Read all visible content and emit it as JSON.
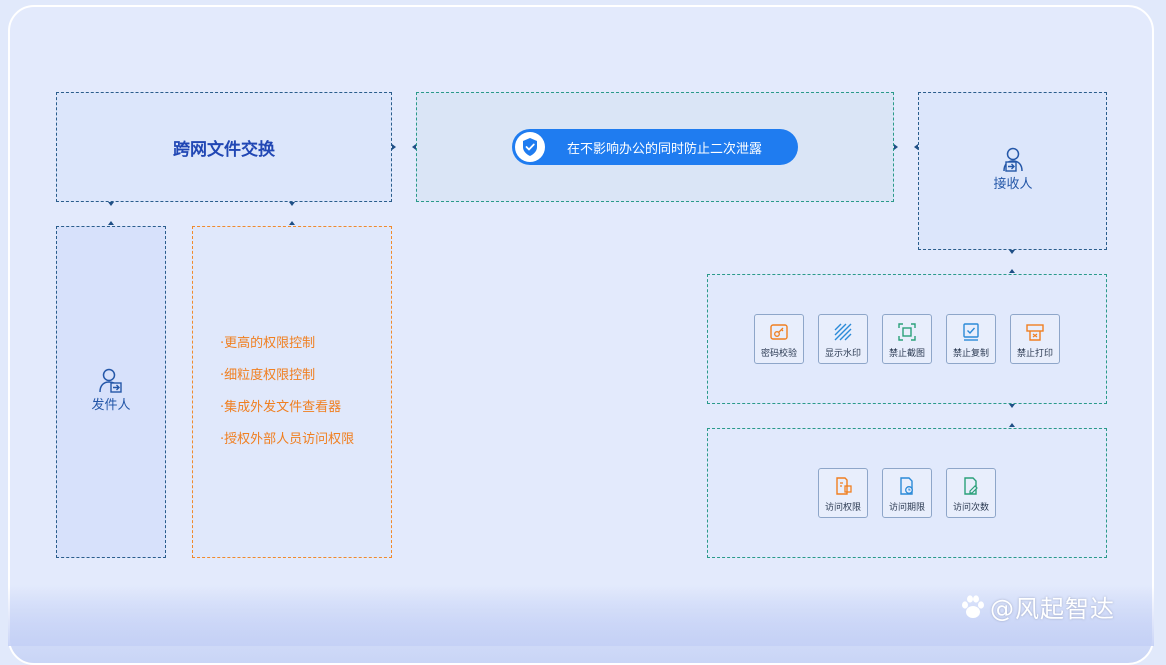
{
  "exchange": {
    "title": "跨网文件交换"
  },
  "center": {
    "banner": "在不影响办公的同时防止二次泄露"
  },
  "receiver": {
    "label": "接收人"
  },
  "sender": {
    "label": "发件人"
  },
  "features": [
    "·更高的权限控制",
    "·细粒度权限控制",
    "·集成外发文件查看器",
    "·授权外部人员访问权限"
  ],
  "protections": [
    {
      "label": "密码校验",
      "icon": "password-check-icon",
      "color": "#f07f20"
    },
    {
      "label": "显示水印",
      "icon": "watermark-icon",
      "color": "#2b8ad8"
    },
    {
      "label": "禁止截图",
      "icon": "no-screenshot-icon",
      "color": "#2aa07a"
    },
    {
      "label": "禁止复制",
      "icon": "no-copy-icon",
      "color": "#2b8ad8"
    },
    {
      "label": "禁止打印",
      "icon": "no-print-icon",
      "color": "#f07f20"
    }
  ],
  "access": [
    {
      "label": "访问权限",
      "icon": "access-permission-icon",
      "color": "#f07f20"
    },
    {
      "label": "访问期限",
      "icon": "access-period-icon",
      "color": "#2b8ad8"
    },
    {
      "label": "访问次数",
      "icon": "access-count-icon",
      "color": "#2aa07a"
    }
  ],
  "watermark": {
    "text": "@风起智达"
  }
}
